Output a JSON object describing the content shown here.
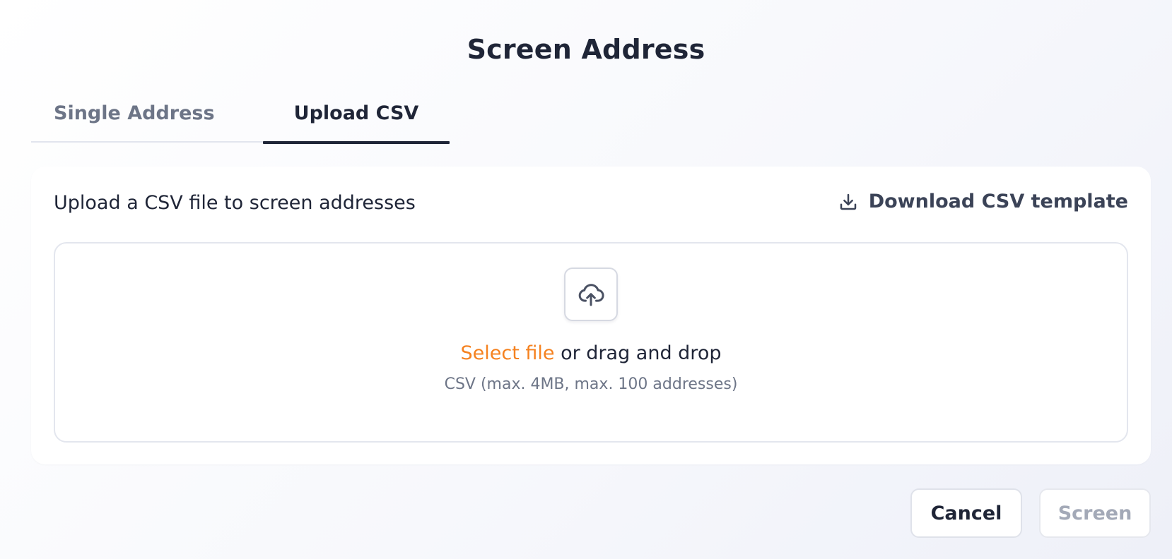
{
  "dialog": {
    "title": "Screen Address"
  },
  "tabs": [
    {
      "label": "Single Address",
      "active": false
    },
    {
      "label": "Upload CSV",
      "active": true
    }
  ],
  "card": {
    "heading": "Upload a CSV file to screen addresses",
    "download_label": "Download CSV template",
    "download_icon": "download-icon"
  },
  "dropzone": {
    "icon": "cloud-upload-icon",
    "select_label": "Select file",
    "drag_label": " or drag and drop",
    "hint": "CSV (max. 4MB, max. 100 addresses)"
  },
  "footer": {
    "cancel_label": "Cancel",
    "screen_label": "Screen",
    "screen_disabled": true
  },
  "colors": {
    "accent": "#f58220",
    "text": "#1f2537",
    "muted": "#6d7587",
    "disabled": "#a3a9b7"
  }
}
